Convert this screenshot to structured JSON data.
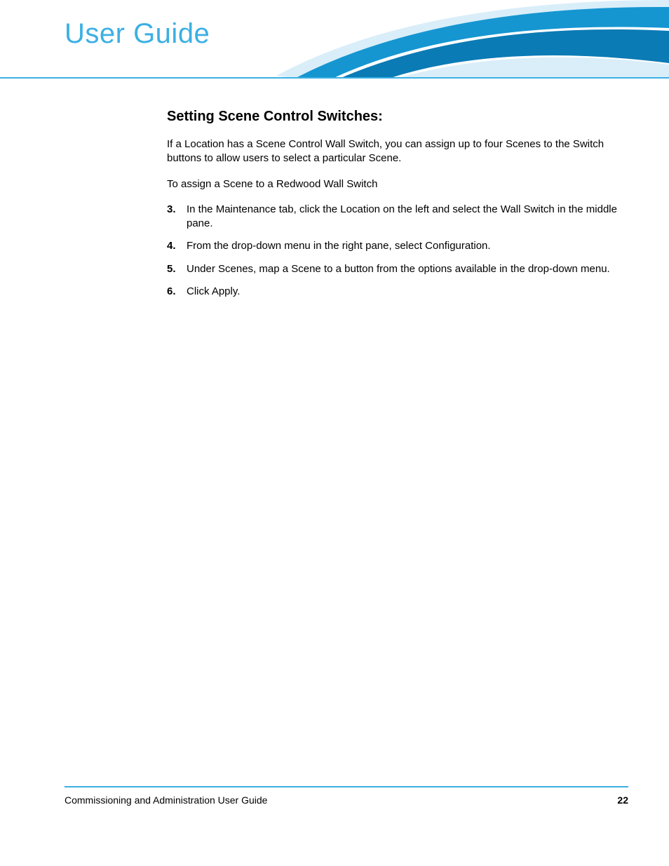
{
  "header": {
    "title": "User Guide"
  },
  "section": {
    "heading": "Setting Scene Control Switches:",
    "intro1": "If a Location has a Scene Control Wall Switch, you can assign up to four Scenes to the Switch buttons to allow users to select a particular Scene.",
    "intro2": "To assign a Scene to a Redwood Wall Switch",
    "steps": [
      "In the Maintenance tab, click the Location on the left and select the Wall Switch in the middle pane.",
      "From the drop-down menu in the right pane, select Configuration.",
      "Under Scenes, map a Scene to a button from the options available in the drop-down menu.",
      "Click Apply."
    ]
  },
  "footer": {
    "doc_title": "Commissioning and Administration User Guide",
    "page": "22"
  },
  "colors": {
    "accent": "#3bb0e3"
  }
}
